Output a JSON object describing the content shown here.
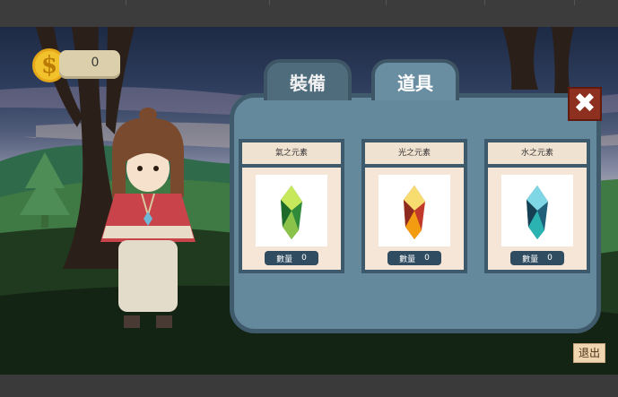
{
  "wallet": {
    "coin_symbol": "$",
    "coin_count": "0"
  },
  "tabs": [
    {
      "label": "裝備",
      "active": false
    },
    {
      "label": "道具",
      "active": true
    }
  ],
  "close_symbol": "✖",
  "items": [
    {
      "name": "氣之元素",
      "qty_label": "數量",
      "qty": "0",
      "icon": "wind-element-crystal-icon",
      "colors": [
        "#2f8a3a",
        "#8bc34a",
        "#c6e85a"
      ]
    },
    {
      "name": "光之元素",
      "qty_label": "數量",
      "qty": "0",
      "icon": "light-element-crystal-icon",
      "colors": [
        "#c0392b",
        "#f39c12",
        "#f7dc6f"
      ]
    },
    {
      "name": "水之元素",
      "qty_label": "數量",
      "qty": "0",
      "icon": "water-element-crystal-icon",
      "colors": [
        "#1f5f7a",
        "#2bb3b1",
        "#7fd7e6"
      ]
    }
  ],
  "exit_label": "退出"
}
